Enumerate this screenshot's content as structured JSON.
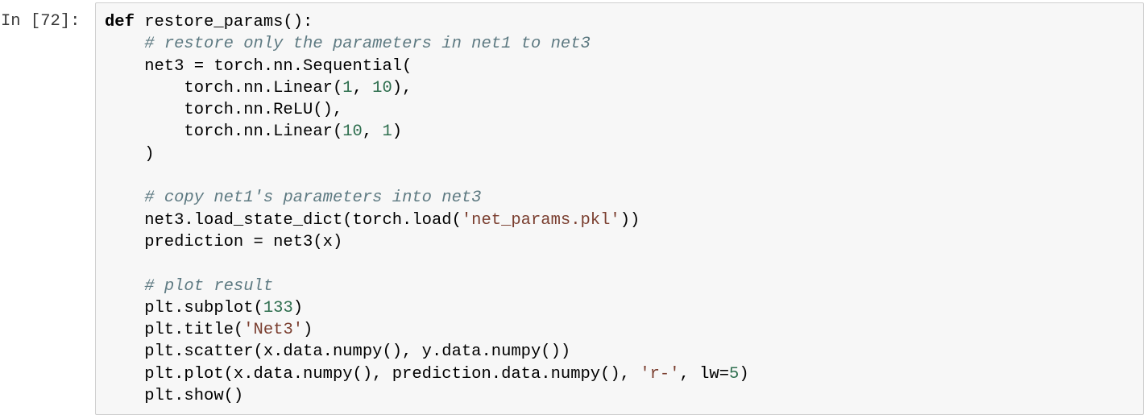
{
  "cell": {
    "prompt": "In [72]:",
    "lines": [
      [
        {
          "t": "kwb",
          "v": "def"
        },
        {
          "t": "txt",
          "v": " restore_params():"
        }
      ],
      [
        {
          "t": "txt",
          "v": "    "
        },
        {
          "t": "cm",
          "v": "# restore only the parameters in net1 to net3"
        }
      ],
      [
        {
          "t": "txt",
          "v": "    net3 = torch.nn.Sequential("
        }
      ],
      [
        {
          "t": "txt",
          "v": "        torch.nn.Linear("
        },
        {
          "t": "num",
          "v": "1"
        },
        {
          "t": "txt",
          "v": ", "
        },
        {
          "t": "num",
          "v": "10"
        },
        {
          "t": "txt",
          "v": "),"
        }
      ],
      [
        {
          "t": "txt",
          "v": "        torch.nn.ReLU(),"
        }
      ],
      [
        {
          "t": "txt",
          "v": "        torch.nn.Linear("
        },
        {
          "t": "num",
          "v": "10"
        },
        {
          "t": "txt",
          "v": ", "
        },
        {
          "t": "num",
          "v": "1"
        },
        {
          "t": "txt",
          "v": ")"
        }
      ],
      [
        {
          "t": "txt",
          "v": "    )"
        }
      ],
      [
        {
          "t": "txt",
          "v": ""
        }
      ],
      [
        {
          "t": "txt",
          "v": "    "
        },
        {
          "t": "cm",
          "v": "# copy net1's parameters into net3"
        }
      ],
      [
        {
          "t": "txt",
          "v": "    net3.load_state_dict(torch.load("
        },
        {
          "t": "str",
          "v": "'net_params.pkl'"
        },
        {
          "t": "txt",
          "v": "))"
        }
      ],
      [
        {
          "t": "txt",
          "v": "    prediction = net3(x)"
        }
      ],
      [
        {
          "t": "txt",
          "v": ""
        }
      ],
      [
        {
          "t": "txt",
          "v": "    "
        },
        {
          "t": "cm",
          "v": "# plot result"
        }
      ],
      [
        {
          "t": "txt",
          "v": "    plt.subplot("
        },
        {
          "t": "num",
          "v": "133"
        },
        {
          "t": "txt",
          "v": ")"
        }
      ],
      [
        {
          "t": "txt",
          "v": "    plt.title("
        },
        {
          "t": "str",
          "v": "'Net3'"
        },
        {
          "t": "txt",
          "v": ")"
        }
      ],
      [
        {
          "t": "txt",
          "v": "    plt.scatter(x.data.numpy(), y.data.numpy())"
        }
      ],
      [
        {
          "t": "txt",
          "v": "    plt.plot(x.data.numpy(), prediction.data.numpy(), "
        },
        {
          "t": "str",
          "v": "'r-'"
        },
        {
          "t": "txt",
          "v": ", lw="
        },
        {
          "t": "num",
          "v": "5"
        },
        {
          "t": "txt",
          "v": ")"
        }
      ],
      [
        {
          "t": "txt",
          "v": "    plt.show()"
        }
      ]
    ]
  },
  "colors": {
    "cell_background": "#f7f7f7",
    "cell_border": "#cfcfcf",
    "comment": "#5e7a82",
    "string": "#7a3e2f",
    "number": "#2f6f4f"
  }
}
